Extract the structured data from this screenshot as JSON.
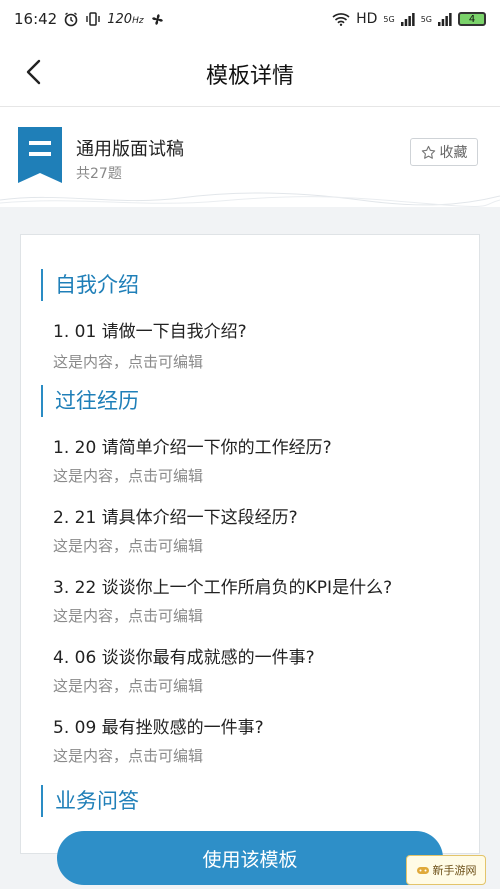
{
  "status_bar": {
    "time": "16:42",
    "refresh_rate": "120",
    "refresh_unit": "Hz",
    "hd_label": "HD",
    "net1": "5G",
    "net2": "5G",
    "battery": "4"
  },
  "header": {
    "title": "模板详情"
  },
  "template": {
    "name": "通用版面试稿",
    "count": "共27题",
    "favorite_label": "收藏"
  },
  "sections": [
    {
      "title": "自我介绍",
      "questions": [
        {
          "label": "1. 01 请做一下自我介绍?",
          "answer": "这是内容，点击可编辑"
        }
      ]
    },
    {
      "title": "过往经历",
      "questions": [
        {
          "label": "1. 20 请简单介绍一下你的工作经历?",
          "answer": "这是内容，点击可编辑"
        },
        {
          "label": "2. 21 请具体介绍一下这段经历?",
          "answer": "这是内容，点击可编辑"
        },
        {
          "label": "3. 22 谈谈你上一个工作所肩负的KPI是什么?",
          "answer": "这是内容，点击可编辑"
        },
        {
          "label": "4. 06 谈谈你最有成就感的一件事?",
          "answer": "这是内容，点击可编辑"
        },
        {
          "label": "5. 09 最有挫败感的一件事?",
          "answer": "这是内容，点击可编辑"
        }
      ]
    },
    {
      "title": "业务问答",
      "questions": []
    }
  ],
  "use_button_label": "使用该模板",
  "watermark_text": "新手游网",
  "colors": {
    "accent": "#2e8fc8",
    "section_text": "#1f7fb8",
    "background": "#f1f3f5"
  }
}
